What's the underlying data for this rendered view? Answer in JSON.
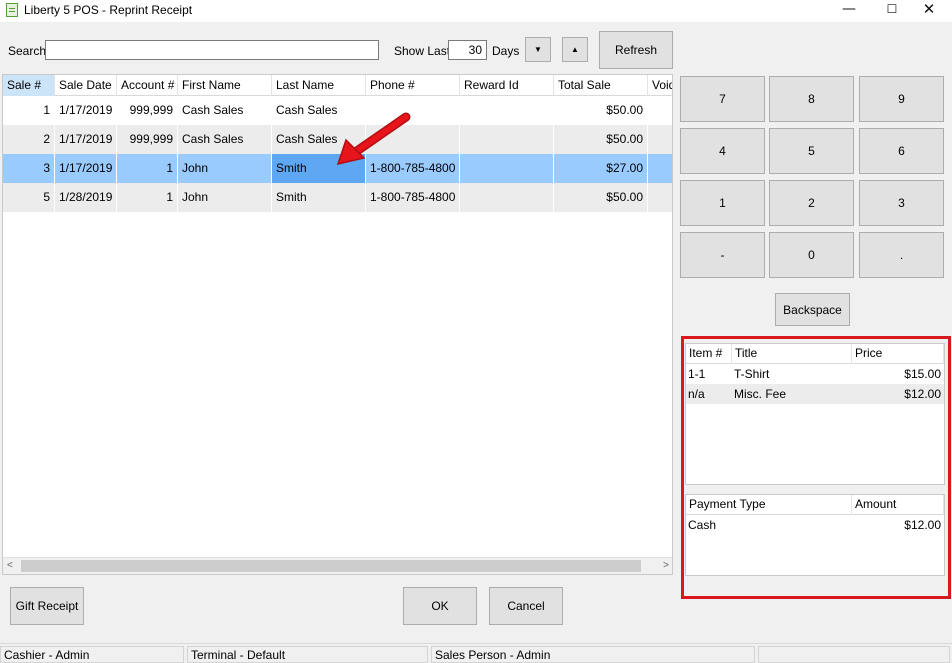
{
  "window": {
    "title": "Liberty 5 POS - Reprint Receipt",
    "min_glyph": "—",
    "max_glyph": "☐",
    "close_glyph": "✕"
  },
  "search": {
    "label": "Search",
    "value": "",
    "show_last_label": "Show Last",
    "days_value": "30",
    "days_label": "Days",
    "down_glyph": "▼",
    "up_glyph": "▲",
    "refresh_label": "Refresh"
  },
  "sales_grid": {
    "columns": [
      "Sale #",
      "Sale Date",
      "Account #",
      "First Name",
      "Last Name",
      "Phone #",
      "Reward Id",
      "Total Sale",
      "Void"
    ],
    "rows": [
      {
        "sale": "1",
        "date": "1/17/2019",
        "account": "999,999",
        "first": "Cash Sales",
        "last": "Cash Sales",
        "phone": "",
        "reward": "",
        "total": "$50.00",
        "void": ""
      },
      {
        "sale": "2",
        "date": "1/17/2019",
        "account": "999,999",
        "first": "Cash Sales",
        "last": "Cash Sales",
        "phone": "",
        "reward": "",
        "total": "$50.00",
        "void": ""
      },
      {
        "sale": "3",
        "date": "1/17/2019",
        "account": "1",
        "first": "John",
        "last": "Smith",
        "phone": "1-800-785-4800",
        "reward": "",
        "total": "$27.00",
        "void": ""
      },
      {
        "sale": "5",
        "date": "1/28/2019",
        "account": "1",
        "first": "John",
        "last": "Smith",
        "phone": "1-800-785-4800",
        "reward": "",
        "total": "$50.00",
        "void": ""
      }
    ],
    "scroll_left_glyph": "<",
    "scroll_right_glyph": ">"
  },
  "keypad": {
    "keys": [
      "7",
      "8",
      "9",
      "4",
      "5",
      "6",
      "1",
      "2",
      "3",
      "-",
      "0",
      "."
    ],
    "backspace_label": "Backspace"
  },
  "items_grid": {
    "columns": [
      "Item #",
      "Title",
      "Price"
    ],
    "rows": [
      {
        "item": "1-1",
        "title": "T-Shirt",
        "price": "$15.00"
      },
      {
        "item": "n/a",
        "title": "Misc. Fee",
        "price": "$12.00"
      }
    ]
  },
  "payment_grid": {
    "columns": [
      "Payment Type",
      "Amount"
    ],
    "rows": [
      {
        "type": "Cash",
        "amount": "$12.00"
      }
    ]
  },
  "footer": {
    "gift_receipt_label": "Gift Receipt",
    "ok_label": "OK",
    "cancel_label": "Cancel"
  },
  "statusbar": {
    "cashier": "Cashier - Admin",
    "terminal": "Terminal - Default",
    "sales_person": "Sales Person - Admin",
    "extra": ""
  },
  "colors": {
    "selected_row": "#99cbff",
    "selected_cell": "#5ea7f2",
    "highlight_frame": "#d7181f",
    "annotation_arrow": "#e8141b"
  }
}
